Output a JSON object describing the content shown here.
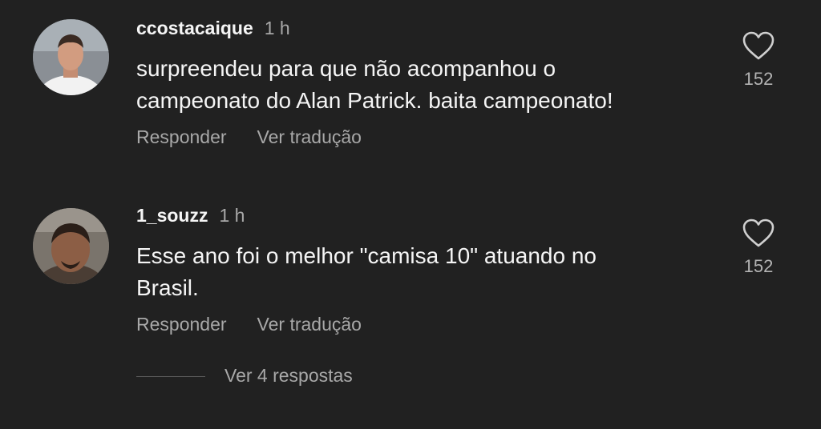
{
  "comments": [
    {
      "username": "ccostacaique",
      "time": "1 h",
      "text_line1": "surpreendeu para que não acompanhou o",
      "text_line2": "campeonato do Alan Patrick. baita campeonato!",
      "reply_label": "Responder",
      "translate_label": "Ver tradução",
      "likes": "152",
      "icon": "heart-outline"
    },
    {
      "username": "1_souzz",
      "time": "1 h",
      "text_line1": "Esse ano foi o melhor \"camisa 10\" atuando no",
      "text_line2": "Brasil.",
      "reply_label": "Responder",
      "translate_label": "Ver tradução",
      "likes": "152",
      "icon": "heart-outline",
      "view_replies": "Ver 4 respostas"
    }
  ],
  "colors": {
    "background": "#212121",
    "primary_text": "#f5f5f5",
    "secondary_text": "#a8a8a8"
  }
}
